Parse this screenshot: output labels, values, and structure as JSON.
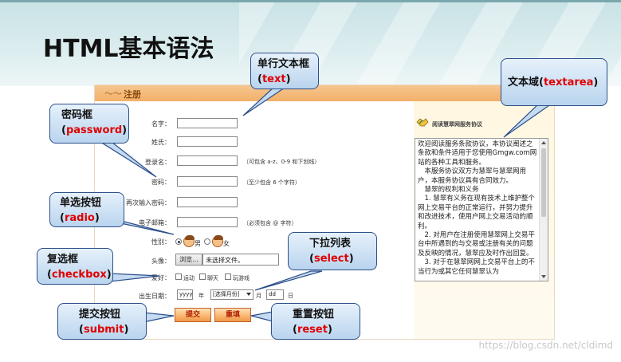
{
  "slide": {
    "title": "HTML基本语法",
    "watermark": "https://blog.csdn.net/cldimd"
  },
  "form": {
    "header": "注册",
    "labels": {
      "name": "名字：",
      "surname": "姓氏：",
      "login": "登录名：",
      "password": "密码：",
      "password_again": "再次输入密码：",
      "email": "电子邮箱：",
      "gender": "性别：",
      "avatar": "头像：",
      "hobby": "爱好：",
      "birthday": "出生日期："
    },
    "hints": {
      "login": "（可包含 a-z、0-9 和下划线）",
      "password": "（至少包含 6 个字符）",
      "email": "（必须包含 @ 字符）"
    },
    "gender": {
      "male": "男",
      "female": "女"
    },
    "avatar": {
      "browse": "浏览...",
      "no_file": "未选择文件。"
    },
    "hobbies": [
      "运动",
      "聊天",
      "玩游戏"
    ],
    "birthday": {
      "year_placeholder": "yyyy",
      "year_unit": "年",
      "month_select": "[选择月份]",
      "month_unit": "月",
      "day_placeholder": "dd",
      "day_unit": "日"
    },
    "submit": "提交",
    "reset": "重填"
  },
  "agreement": {
    "title": "阅读慧翠网服务协议",
    "text": "欢迎阅读服务条款协议，本协议阐述之条款和条件适用于您使用Gmgw.com网站的各种工具和服务。\n　本服务协议双方为慧翠与慧翠网用户，本服务协议具有合同效力。\n　慧翠的权利和义务\n　1. 慧翠有义务在现有技术上维护整个网上交易平台的正常运行，并努力提升和改进技术，使用户网上交易活动的顺利。\n　2. 对用户在注册使用慧翠网上交易平台中所遇到的与交易或注册有关的问题及反映的情况，慧翠应及时作出回复。\n　3. 对于在慧翠网网上交易平台上的不当行为或其它任何慧翠认为"
  },
  "callouts": {
    "text": {
      "prefix": "单行文本框(",
      "keyword": "text",
      "suffix": ")"
    },
    "password": {
      "prefix": "密码框",
      "keyword": "password"
    },
    "radio": {
      "prefix": "单选按钮",
      "keyword": "radio"
    },
    "checkbox": {
      "prefix": "复选框",
      "keyword": "checkbox"
    },
    "submit": {
      "prefix": "提交按钮",
      "keyword": "submit"
    },
    "select": {
      "prefix": "下拉列表",
      "keyword": "select"
    },
    "reset": {
      "prefix": "重置按钮",
      "keyword": "reset"
    },
    "textarea": {
      "prefix": "文本域(",
      "keyword": "textarea",
      "suffix": ")"
    }
  },
  "colors": {
    "keyword": "#e00000",
    "callout_border": "#2d4f8a",
    "header_band": "#c8e2e5",
    "panel_header": "#f2b06a",
    "button": "#f9b873"
  }
}
